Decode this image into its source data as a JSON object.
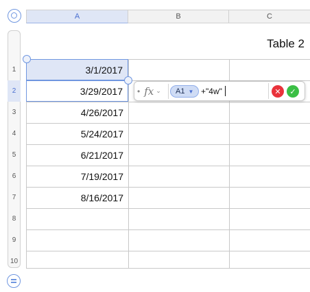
{
  "columns": [
    "A",
    "B",
    "C"
  ],
  "rows": [
    "1",
    "2",
    "3",
    "4",
    "5",
    "6",
    "7",
    "8",
    "9",
    "10"
  ],
  "table_title": "Table 2",
  "cells_a": [
    "3/1/2017",
    "3/29/2017",
    "4/26/2017",
    "5/24/2017",
    "6/21/2017",
    "7/19/2017",
    "8/16/2017",
    "",
    "",
    ""
  ],
  "formula": {
    "fx_label": "fx",
    "reference_token": "A1",
    "expression": "+\"4w\""
  },
  "colors": {
    "accent": "#6f96e0",
    "selection_fill": "#dfe6f6",
    "cancel": "#e9323b",
    "accept": "#3bbf45"
  },
  "icons": [
    "table-select-icon",
    "row-menu-icon",
    "fx-icon",
    "chevron-down-icon",
    "cancel-icon",
    "accept-icon"
  ]
}
